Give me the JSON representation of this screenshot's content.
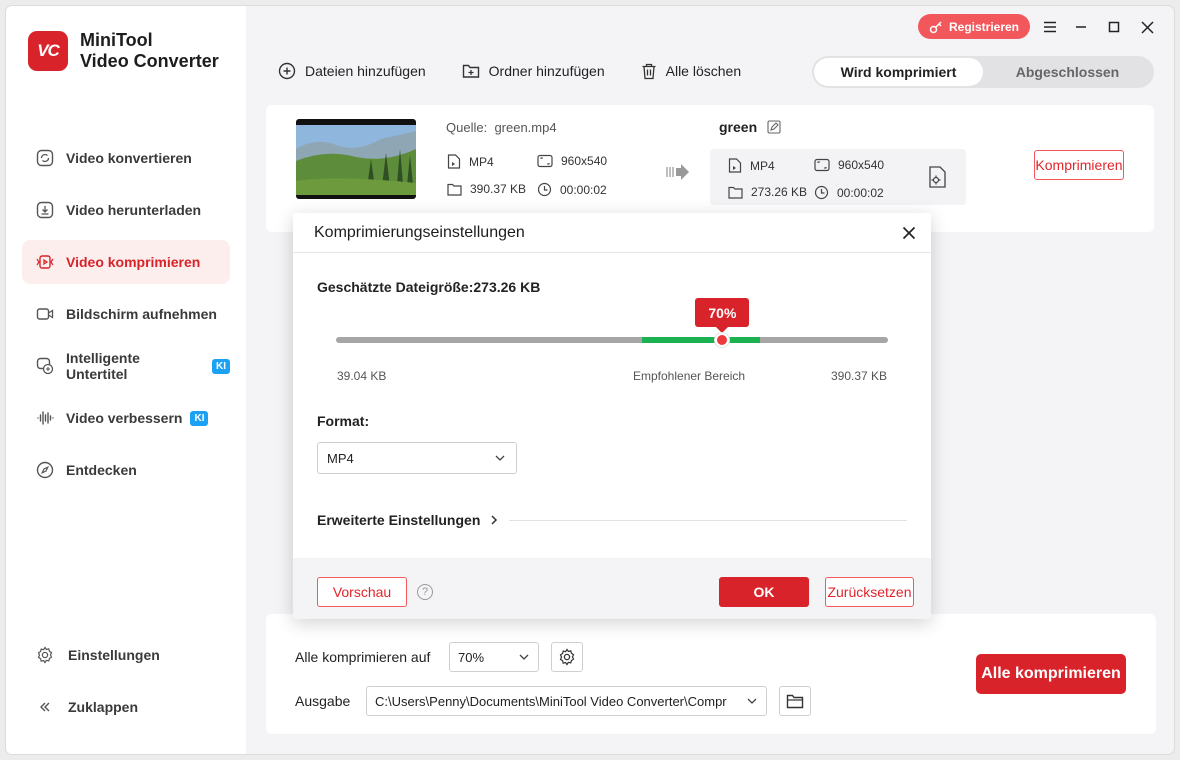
{
  "app": {
    "name_line1": "MiniTool",
    "name_line2": "Video Converter",
    "logo_text": "VC",
    "accent": "#d8232a"
  },
  "titlebar": {
    "register_label": "Registrieren"
  },
  "sidebar": {
    "items": [
      {
        "label": "Video konvertieren",
        "icon": "convert-icon"
      },
      {
        "label": "Video herunterladen",
        "icon": "download-icon"
      },
      {
        "label": "Video komprimieren",
        "icon": "compress-icon",
        "active": true
      },
      {
        "label": "Bildschirm aufnehmen",
        "icon": "camera-icon"
      },
      {
        "label": "Intelligente Untertitel",
        "icon": "subtitle-icon",
        "badge": "KI"
      },
      {
        "label": "Video verbessern",
        "icon": "waveform-icon",
        "badge": "KI"
      },
      {
        "label": "Entdecken",
        "icon": "compass-icon"
      }
    ],
    "settings_label": "Einstellungen",
    "collapse_label": "Zuklappen"
  },
  "toolbar": {
    "add_files": "Dateien hinzufügen",
    "add_folder": "Ordner hinzufügen",
    "clear_all": "Alle löschen",
    "tab_active": "Wird komprimiert",
    "tab_done": "Abgeschlossen"
  },
  "file": {
    "source_label": "Quelle:",
    "source_name": "green.mp4",
    "src_format": "MP4",
    "src_resolution": "960x540",
    "src_size": "390.37 KB",
    "src_duration": "00:00:02",
    "out_name": "green",
    "out_format": "MP4",
    "out_resolution": "960x540",
    "out_size": "273.26 KB",
    "out_duration": "00:00:02",
    "compress_label": "Komprimieren"
  },
  "dialog": {
    "title": "Komprimierungseinstellungen",
    "estimated_label": "Geschätzte Dateigröße:273.26 KB",
    "slider_value_label": "70%",
    "slider_value": 0.7,
    "min_label": "39.04 KB",
    "recommended_label": "Empfohlener Bereich",
    "max_label": "390.37 KB",
    "format_label": "Format:",
    "format_value": "MP4",
    "advanced_label": "Erweiterte Einstellungen",
    "preview_label": "Vorschau",
    "help_glyph": "?",
    "ok_label": "OK",
    "reset_label": "Zurücksetzen"
  },
  "bottom": {
    "compress_all_to_label": "Alle komprimieren auf",
    "compress_all_value": "70%",
    "output_label": "Ausgabe",
    "output_path": "C:\\Users\\Penny\\Documents\\MiniTool Video Converter\\Compr",
    "compress_all_button": "Alle komprimieren"
  }
}
